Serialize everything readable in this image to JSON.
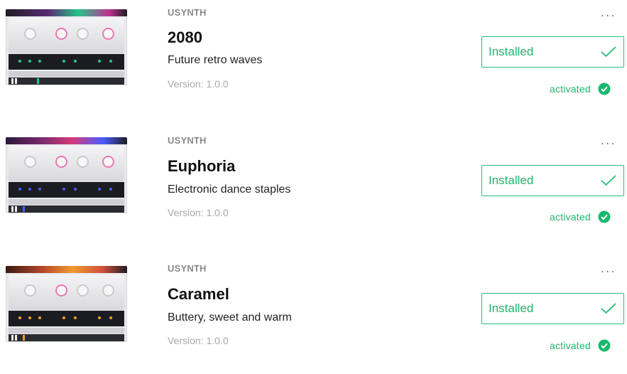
{
  "products": [
    {
      "vendor": "USYNTH",
      "name": "2080",
      "description": "Future retro waves",
      "version": "Version: 1.0.0",
      "status_button": "Installed",
      "activation": "activated",
      "more": "...",
      "thumbnail_theme": {
        "top": "#5a2a74",
        "dots": "#27c48a"
      }
    },
    {
      "vendor": "USYNTH",
      "name": "Euphoria",
      "description": "Electronic dance staples",
      "version": "Version: 1.0.0",
      "status_button": "Installed",
      "activation": "activated",
      "more": "...",
      "thumbnail_theme": {
        "top": "#7a2a6e",
        "dots": "#4a5cff"
      }
    },
    {
      "vendor": "USYNTH",
      "name": "Caramel",
      "description": "Buttery, sweet and warm",
      "version": "Version: 1.0.0",
      "status_button": "Installed",
      "activation": "activated",
      "more": "...",
      "thumbnail_theme": {
        "top": "#b4462a",
        "dots": "#f0a020"
      }
    }
  ],
  "colors": {
    "accent": "#1ab86e",
    "muted": "#8a8a8a"
  }
}
